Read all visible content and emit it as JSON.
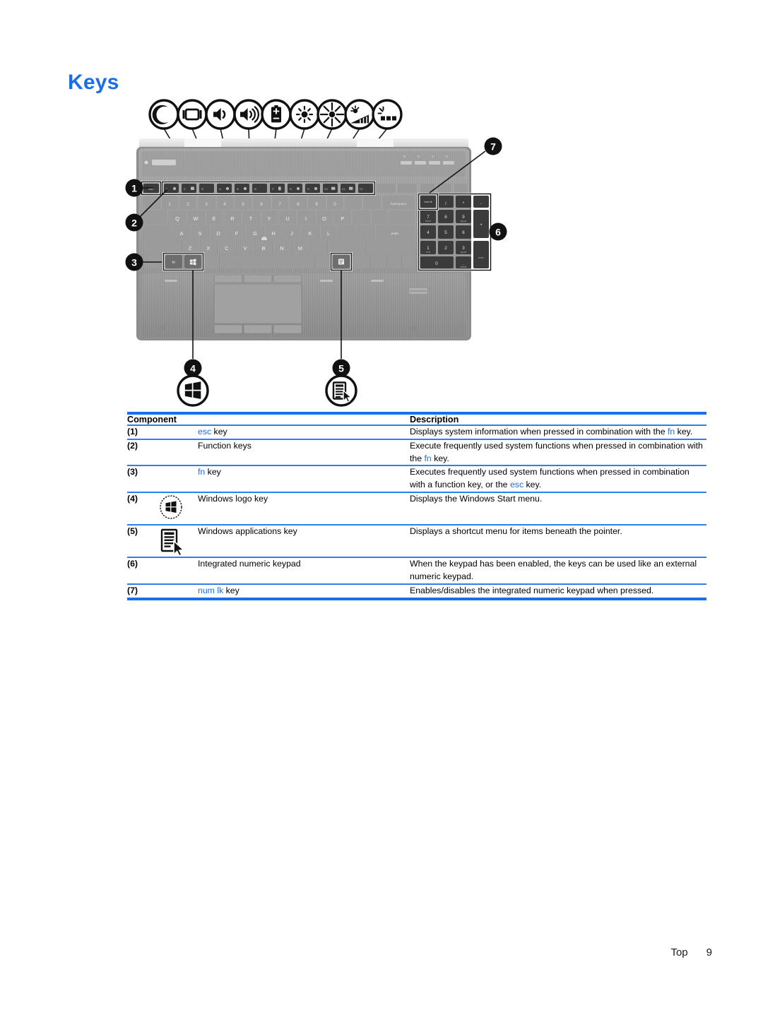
{
  "page": {
    "heading": "Keys",
    "footer_label": "Top",
    "footer_page": "9",
    "accent_color": "#1a6fe8",
    "rule_color": "#2f7fe8"
  },
  "illustration": {
    "name": "laptop-top-view-keyboard-diagram",
    "callouts": [
      {
        "id": "1",
        "number": "1",
        "target": "esc-key"
      },
      {
        "id": "2",
        "number": "2",
        "target": "function-keys"
      },
      {
        "id": "3",
        "number": "3",
        "target": "fn-key"
      },
      {
        "id": "4",
        "number": "4",
        "target": "windows-logo-key"
      },
      {
        "id": "5",
        "number": "5",
        "target": "windows-applications-key"
      },
      {
        "id": "6",
        "number": "6",
        "target": "integrated-numeric-keypad"
      },
      {
        "id": "7",
        "number": "7",
        "target": "num-lk-key"
      }
    ],
    "action_key_icons": [
      {
        "name": "sleep-moon-icon"
      },
      {
        "name": "display-switch-icon"
      },
      {
        "name": "volume-mute-icon"
      },
      {
        "name": "volume-up-icon"
      },
      {
        "name": "battery-icon"
      },
      {
        "name": "brightness-down-icon"
      },
      {
        "name": "brightness-up-icon"
      },
      {
        "name": "ambient-light-sensor-icon"
      },
      {
        "name": "keyboard-backlight-icon"
      }
    ],
    "bottom_icons": [
      {
        "name": "windows-logo-icon"
      },
      {
        "name": "windows-applications-icon"
      }
    ]
  },
  "table": {
    "headers": {
      "component": "Component",
      "description": "Description"
    },
    "rows": [
      {
        "num": "(1)",
        "icon": "",
        "component_pre": "",
        "component_kw": "esc",
        "component_post": " key",
        "desc_parts": [
          {
            "t": "Displays system information when pressed in combination with the ",
            "kw": false
          },
          {
            "t": "fn",
            "kw": true
          },
          {
            "t": " key.",
            "kw": false
          }
        ]
      },
      {
        "num": "(2)",
        "icon": "",
        "component_pre": "Function keys",
        "component_kw": "",
        "component_post": "",
        "desc_parts": [
          {
            "t": "Execute frequently used system functions when pressed in combination with the ",
            "kw": false
          },
          {
            "t": "fn",
            "kw": true
          },
          {
            "t": " key.",
            "kw": false
          }
        ]
      },
      {
        "num": "(3)",
        "icon": "",
        "component_pre": "",
        "component_kw": "fn",
        "component_post": " key",
        "desc_parts": [
          {
            "t": "Executes frequently used system functions when pressed in combination with a function key, or the ",
            "kw": false
          },
          {
            "t": "esc",
            "kw": true
          },
          {
            "t": " key.",
            "kw": false
          }
        ]
      },
      {
        "num": "(4)",
        "icon": "windows-logo-icon",
        "component_pre": "Windows logo key",
        "component_kw": "",
        "component_post": "",
        "desc_parts": [
          {
            "t": "Displays the Windows Start menu.",
            "kw": false
          }
        ]
      },
      {
        "num": "(5)",
        "icon": "windows-applications-icon",
        "component_pre": "Windows applications key",
        "component_kw": "",
        "component_post": "",
        "desc_parts": [
          {
            "t": "Displays a shortcut menu for items beneath the pointer.",
            "kw": false
          }
        ]
      },
      {
        "num": "(6)",
        "icon": "",
        "component_pre": "Integrated numeric keypad",
        "component_kw": "",
        "component_post": "",
        "desc_parts": [
          {
            "t": "When the keypad has been enabled, the keys can be used like an external numeric keypad.",
            "kw": false
          }
        ]
      },
      {
        "num": "(7)",
        "icon": "",
        "component_pre": "",
        "component_kw": "num lk",
        "component_post": " key",
        "desc_parts": [
          {
            "t": "Enables/disables the integrated numeric keypad when pressed.",
            "kw": false
          }
        ]
      }
    ]
  }
}
